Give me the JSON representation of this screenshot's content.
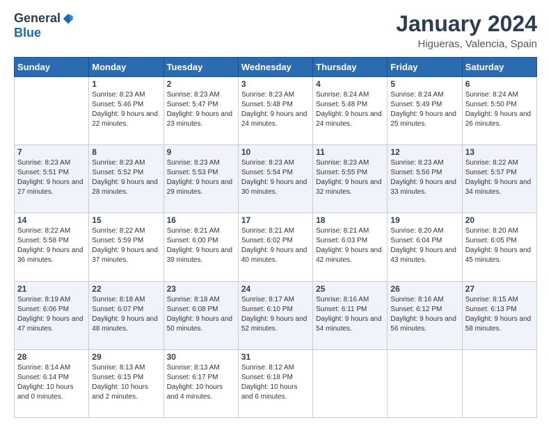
{
  "logo": {
    "general": "General",
    "blue": "Blue"
  },
  "title": "January 2024",
  "subtitle": "Higueras, Valencia, Spain",
  "weekdays": [
    "Sunday",
    "Monday",
    "Tuesday",
    "Wednesday",
    "Thursday",
    "Friday",
    "Saturday"
  ],
  "weeks": [
    [
      {
        "num": "",
        "sunrise": "",
        "sunset": "",
        "daylight": ""
      },
      {
        "num": "1",
        "sunrise": "Sunrise: 8:23 AM",
        "sunset": "Sunset: 5:46 PM",
        "daylight": "Daylight: 9 hours and 22 minutes."
      },
      {
        "num": "2",
        "sunrise": "Sunrise: 8:23 AM",
        "sunset": "Sunset: 5:47 PM",
        "daylight": "Daylight: 9 hours and 23 minutes."
      },
      {
        "num": "3",
        "sunrise": "Sunrise: 8:23 AM",
        "sunset": "Sunset: 5:48 PM",
        "daylight": "Daylight: 9 hours and 24 minutes."
      },
      {
        "num": "4",
        "sunrise": "Sunrise: 8:24 AM",
        "sunset": "Sunset: 5:48 PM",
        "daylight": "Daylight: 9 hours and 24 minutes."
      },
      {
        "num": "5",
        "sunrise": "Sunrise: 8:24 AM",
        "sunset": "Sunset: 5:49 PM",
        "daylight": "Daylight: 9 hours and 25 minutes."
      },
      {
        "num": "6",
        "sunrise": "Sunrise: 8:24 AM",
        "sunset": "Sunset: 5:50 PM",
        "daylight": "Daylight: 9 hours and 26 minutes."
      }
    ],
    [
      {
        "num": "7",
        "sunrise": "Sunrise: 8:23 AM",
        "sunset": "Sunset: 5:51 PM",
        "daylight": "Daylight: 9 hours and 27 minutes."
      },
      {
        "num": "8",
        "sunrise": "Sunrise: 8:23 AM",
        "sunset": "Sunset: 5:52 PM",
        "daylight": "Daylight: 9 hours and 28 minutes."
      },
      {
        "num": "9",
        "sunrise": "Sunrise: 8:23 AM",
        "sunset": "Sunset: 5:53 PM",
        "daylight": "Daylight: 9 hours and 29 minutes."
      },
      {
        "num": "10",
        "sunrise": "Sunrise: 8:23 AM",
        "sunset": "Sunset: 5:54 PM",
        "daylight": "Daylight: 9 hours and 30 minutes."
      },
      {
        "num": "11",
        "sunrise": "Sunrise: 8:23 AM",
        "sunset": "Sunset: 5:55 PM",
        "daylight": "Daylight: 9 hours and 32 minutes."
      },
      {
        "num": "12",
        "sunrise": "Sunrise: 8:23 AM",
        "sunset": "Sunset: 5:56 PM",
        "daylight": "Daylight: 9 hours and 33 minutes."
      },
      {
        "num": "13",
        "sunrise": "Sunrise: 8:22 AM",
        "sunset": "Sunset: 5:57 PM",
        "daylight": "Daylight: 9 hours and 34 minutes."
      }
    ],
    [
      {
        "num": "14",
        "sunrise": "Sunrise: 8:22 AM",
        "sunset": "Sunset: 5:58 PM",
        "daylight": "Daylight: 9 hours and 36 minutes."
      },
      {
        "num": "15",
        "sunrise": "Sunrise: 8:22 AM",
        "sunset": "Sunset: 5:59 PM",
        "daylight": "Daylight: 9 hours and 37 minutes."
      },
      {
        "num": "16",
        "sunrise": "Sunrise: 8:21 AM",
        "sunset": "Sunset: 6:00 PM",
        "daylight": "Daylight: 9 hours and 39 minutes."
      },
      {
        "num": "17",
        "sunrise": "Sunrise: 8:21 AM",
        "sunset": "Sunset: 6:02 PM",
        "daylight": "Daylight: 9 hours and 40 minutes."
      },
      {
        "num": "18",
        "sunrise": "Sunrise: 8:21 AM",
        "sunset": "Sunset: 6:03 PM",
        "daylight": "Daylight: 9 hours and 42 minutes."
      },
      {
        "num": "19",
        "sunrise": "Sunrise: 8:20 AM",
        "sunset": "Sunset: 6:04 PM",
        "daylight": "Daylight: 9 hours and 43 minutes."
      },
      {
        "num": "20",
        "sunrise": "Sunrise: 8:20 AM",
        "sunset": "Sunset: 6:05 PM",
        "daylight": "Daylight: 9 hours and 45 minutes."
      }
    ],
    [
      {
        "num": "21",
        "sunrise": "Sunrise: 8:19 AM",
        "sunset": "Sunset: 6:06 PM",
        "daylight": "Daylight: 9 hours and 47 minutes."
      },
      {
        "num": "22",
        "sunrise": "Sunrise: 8:18 AM",
        "sunset": "Sunset: 6:07 PM",
        "daylight": "Daylight: 9 hours and 48 minutes."
      },
      {
        "num": "23",
        "sunrise": "Sunrise: 8:18 AM",
        "sunset": "Sunset: 6:08 PM",
        "daylight": "Daylight: 9 hours and 50 minutes."
      },
      {
        "num": "24",
        "sunrise": "Sunrise: 8:17 AM",
        "sunset": "Sunset: 6:10 PM",
        "daylight": "Daylight: 9 hours and 52 minutes."
      },
      {
        "num": "25",
        "sunrise": "Sunrise: 8:16 AM",
        "sunset": "Sunset: 6:11 PM",
        "daylight": "Daylight: 9 hours and 54 minutes."
      },
      {
        "num": "26",
        "sunrise": "Sunrise: 8:16 AM",
        "sunset": "Sunset: 6:12 PM",
        "daylight": "Daylight: 9 hours and 56 minutes."
      },
      {
        "num": "27",
        "sunrise": "Sunrise: 8:15 AM",
        "sunset": "Sunset: 6:13 PM",
        "daylight": "Daylight: 9 hours and 58 minutes."
      }
    ],
    [
      {
        "num": "28",
        "sunrise": "Sunrise: 8:14 AM",
        "sunset": "Sunset: 6:14 PM",
        "daylight": "Daylight: 10 hours and 0 minutes."
      },
      {
        "num": "29",
        "sunrise": "Sunrise: 8:13 AM",
        "sunset": "Sunset: 6:15 PM",
        "daylight": "Daylight: 10 hours and 2 minutes."
      },
      {
        "num": "30",
        "sunrise": "Sunrise: 8:13 AM",
        "sunset": "Sunset: 6:17 PM",
        "daylight": "Daylight: 10 hours and 4 minutes."
      },
      {
        "num": "31",
        "sunrise": "Sunrise: 8:12 AM",
        "sunset": "Sunset: 6:18 PM",
        "daylight": "Daylight: 10 hours and 6 minutes."
      },
      {
        "num": "",
        "sunrise": "",
        "sunset": "",
        "daylight": ""
      },
      {
        "num": "",
        "sunrise": "",
        "sunset": "",
        "daylight": ""
      },
      {
        "num": "",
        "sunrise": "",
        "sunset": "",
        "daylight": ""
      }
    ]
  ]
}
